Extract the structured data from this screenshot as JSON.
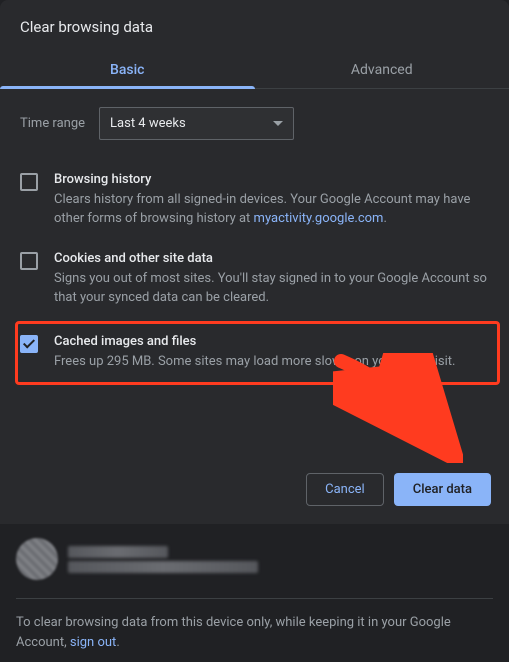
{
  "dialog": {
    "title": "Clear browsing data",
    "tabs": {
      "basic": "Basic",
      "advanced": "Advanced"
    },
    "time_range": {
      "label": "Time range",
      "value": "Last 4 weeks"
    },
    "options": [
      {
        "title": "Browsing history",
        "desc_pre": "Clears history from all signed-in devices. Your Google Account may have other forms of browsing history at ",
        "link": "myactivity.google.com",
        "desc_post": ".",
        "checked": false
      },
      {
        "title": "Cookies and other site data",
        "desc": "Signs you out of most sites. You'll stay signed in to your Google Account so that your synced data can be cleared.",
        "checked": false
      },
      {
        "title": "Cached images and files",
        "desc": "Frees up 295 MB. Some sites may load more slowly on your next visit.",
        "checked": true,
        "highlighted": true
      }
    ],
    "buttons": {
      "cancel": "Cancel",
      "clear": "Clear data"
    }
  },
  "footer": {
    "text_pre": "To clear browsing data from this device only, while keeping it in your Google Account, ",
    "link": "sign out",
    "text_post": "."
  },
  "colors": {
    "accent": "#8ab4f8",
    "highlight": "#ff3b1f"
  }
}
